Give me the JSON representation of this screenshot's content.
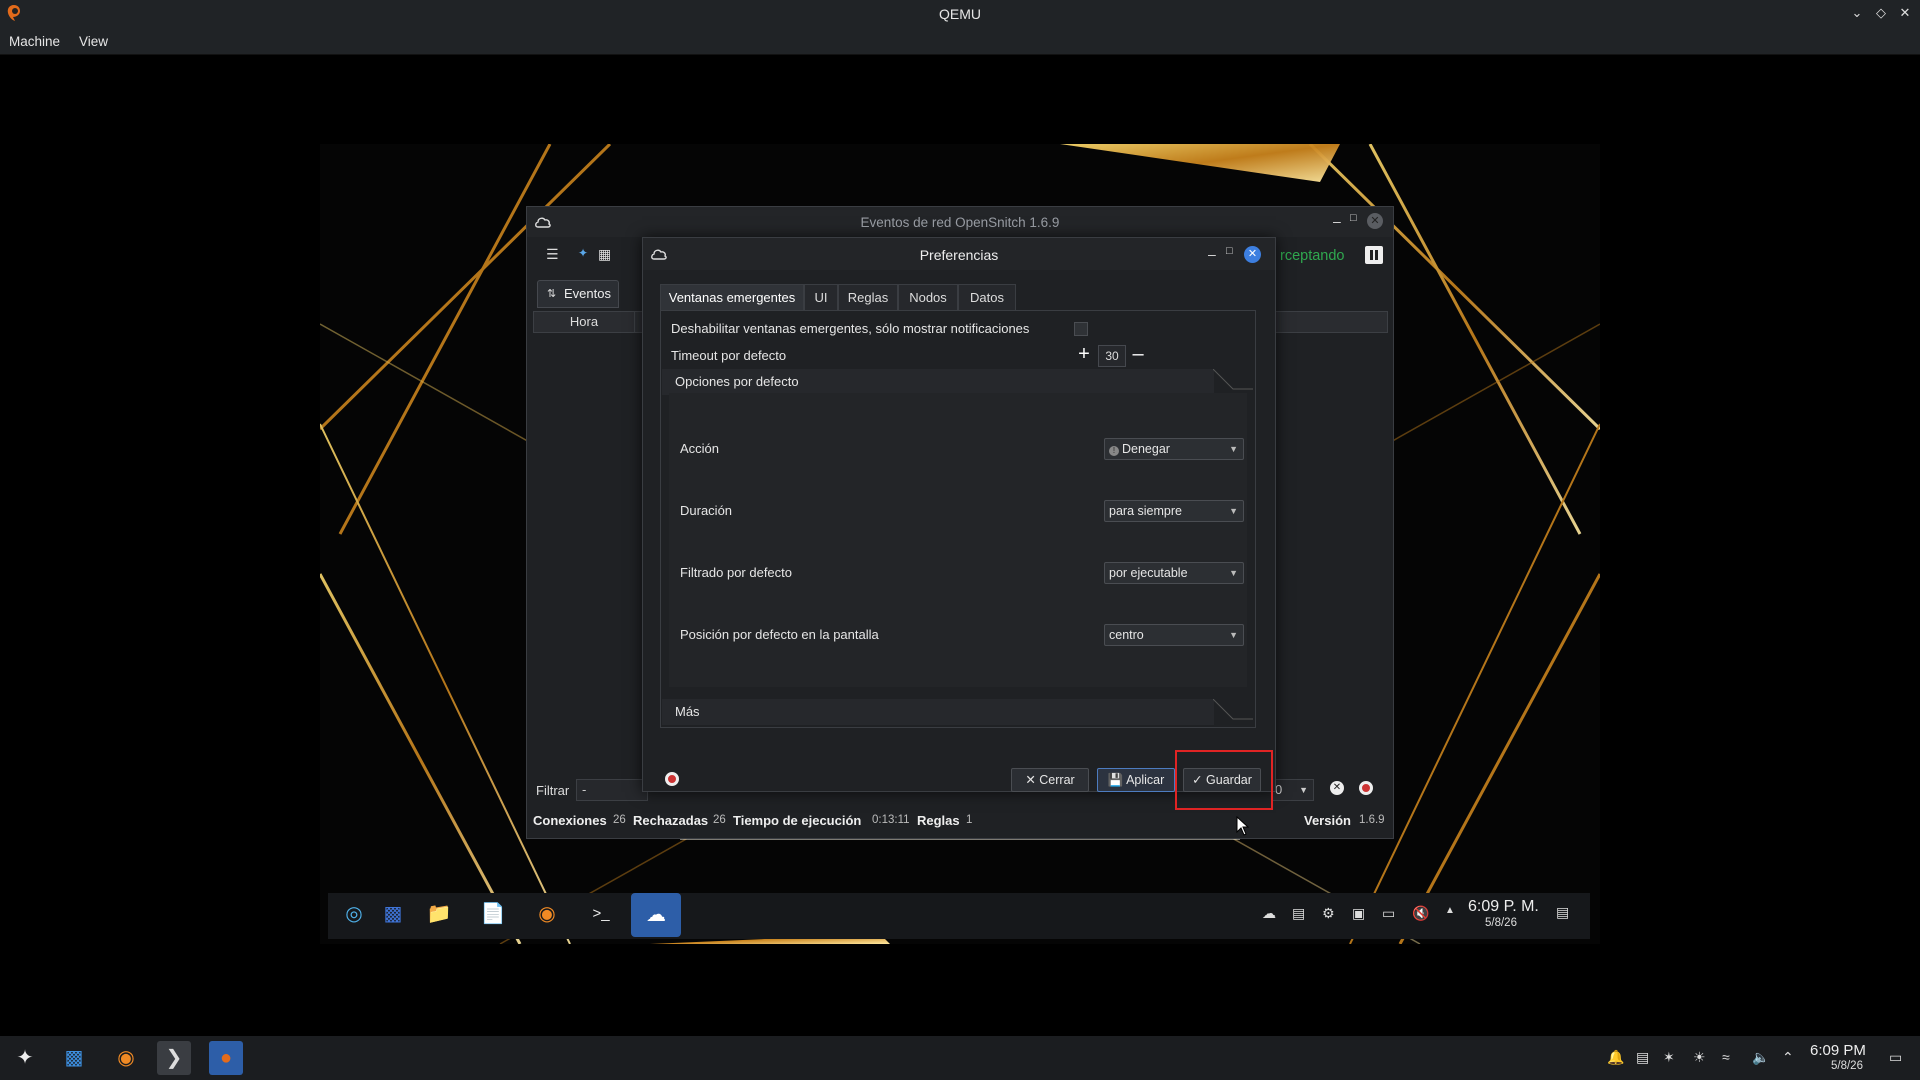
{
  "qemu": {
    "title": "QEMU",
    "menu": [
      "Machine",
      "View"
    ],
    "controls": [
      "chevron-down-icon",
      "restore-icon",
      "close-icon"
    ]
  },
  "main_window": {
    "title": "Eventos de red OpenSnitch 1.6.9",
    "tab_eventos": "Eventos",
    "column_hora": "Hora",
    "interceptando": "rceptando",
    "filter_label": "Filtrar",
    "filter_value": "-",
    "limit_value": "0",
    "status": {
      "conexiones_label": "Conexiones",
      "conexiones_value": "26",
      "rechazadas_label": "Rechazadas",
      "rechazadas_value": "26",
      "tiempo_label": "Tiempo de ejecución",
      "tiempo_value": "0:13:11",
      "reglas_label": "Reglas",
      "reglas_value": "1",
      "version_label": "Versión",
      "version_value": "1.6.9"
    }
  },
  "prefs": {
    "title": "Preferencias",
    "tabs": [
      "Ventanas emergentes",
      "UI",
      "Reglas",
      "Nodos",
      "Datos"
    ],
    "disable_popups_label": "Deshabilitar ventanas emergentes, sólo mostrar notificaciones",
    "disable_popups_checked": false,
    "timeout_label": "Timeout por defecto",
    "timeout_value": "30",
    "group_defaults": "Opciones por defecto",
    "rows": [
      {
        "label": "Acción",
        "value": "Denegar"
      },
      {
        "label": "Duración",
        "value": "para siempre"
      },
      {
        "label": "Filtrado por defecto",
        "value": "por ejecutable"
      },
      {
        "label": "Posición por defecto en la pantalla",
        "value": "centro"
      }
    ],
    "group_more": "Más",
    "buttons": {
      "close": "Cerrar",
      "apply": "Aplicar",
      "save": "Guardar"
    }
  },
  "guest_tray": {
    "time": "6:09 P. M.",
    "date": "5/8/26"
  },
  "host_tray": {
    "time": "6:09 PM",
    "date": "5/8/26"
  },
  "colors": {
    "highlight": "#e02424",
    "accent": "#3d7fe0",
    "interceptando": "#2fa84f"
  }
}
